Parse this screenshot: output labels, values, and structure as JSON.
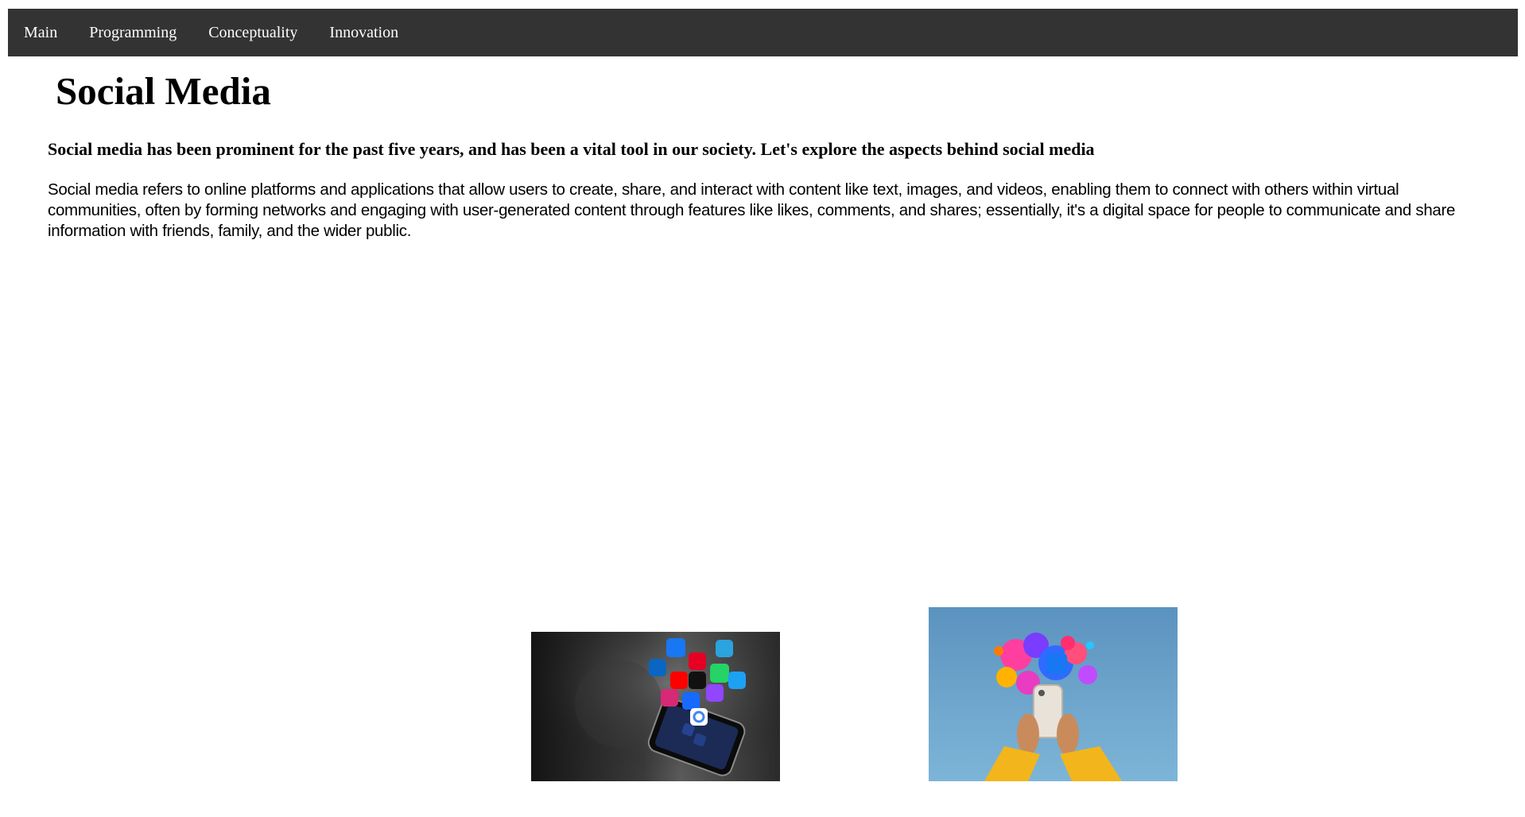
{
  "nav": {
    "items": [
      {
        "label": "Main"
      },
      {
        "label": "Programming"
      },
      {
        "label": "Conceptuality"
      },
      {
        "label": "Innovation"
      }
    ]
  },
  "main": {
    "title": "Social Media",
    "subtitle": "Social media has been prominent for the past five years, and has been a vital tool in our society. Let's explore the aspects behind social media",
    "paragraph": "Social media refers to online platforms and applications that allow users to create, share, and interact with content like text, images, and videos, enabling them to connect with others within virtual communities, often by forming networks and engaging with user-generated content through features like likes, comments, and shares; essentially, it's a digital space for people to communicate and share information with friends, family, and the wider public."
  },
  "images": [
    {
      "name": "smartphone-app-icons-image"
    },
    {
      "name": "hands-holding-phone-image"
    }
  ],
  "colors": {
    "navbar_bg": "#333333",
    "nav_text": "#ffffff",
    "page_bg": "#ffffff"
  }
}
